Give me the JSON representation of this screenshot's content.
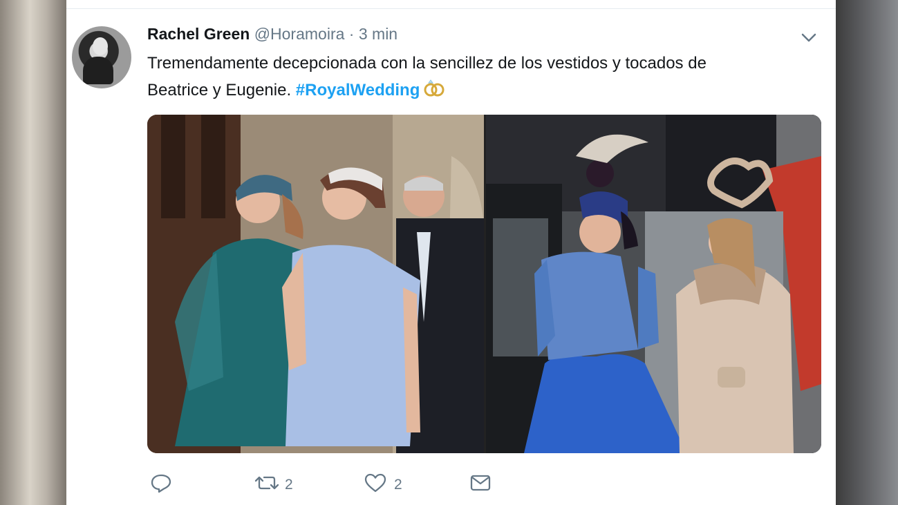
{
  "tweet": {
    "author_name": "Rachel Green",
    "handle": "@Horamoira",
    "separator": "·",
    "time": "3 min",
    "text_line1": "Tremendamente decepcionada con la sencillez de los vestidos y tocados de",
    "text_line2": "Beatrice y Eugenie. ",
    "hashtag": "#RoyalWedding"
  },
  "actions": {
    "retweets": "2",
    "likes": "2"
  },
  "colors": {
    "accent": "#1da1f2",
    "text": "#14171a",
    "muted": "#657786"
  },
  "icons": [
    "chevron-down-icon",
    "reply-icon",
    "retweet-icon",
    "like-icon",
    "message-icon",
    "wedding-rings-icon"
  ]
}
